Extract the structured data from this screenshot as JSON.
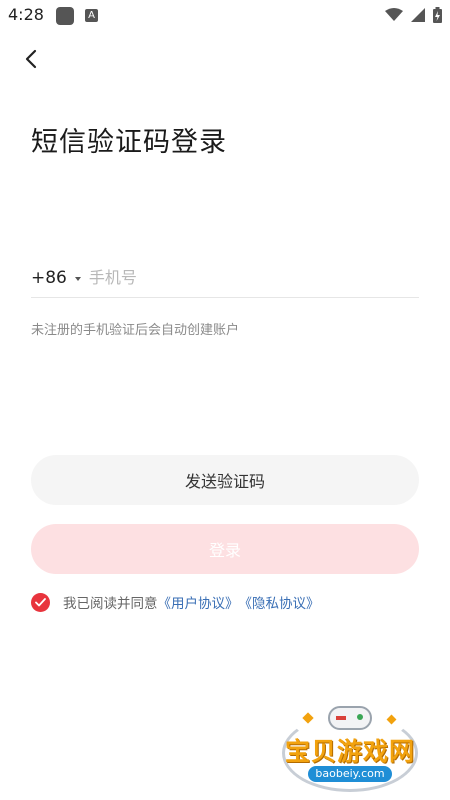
{
  "status_bar": {
    "time": "4:28",
    "app_icon_letter": "A"
  },
  "header": {
    "title": "短信验证码登录"
  },
  "phone": {
    "country_code": "+86",
    "value": "",
    "placeholder": "手机号"
  },
  "hint": "未注册的手机验证后会自动创建账户",
  "buttons": {
    "send_code": "发送验证码",
    "login": "登录"
  },
  "agreement": {
    "checked": true,
    "prefix": "我已阅读并同意",
    "user_agreement": "《用户协议》",
    "privacy_policy": "《隐私协议》"
  },
  "watermark": {
    "name": "宝贝游戏网",
    "url": "baobeiy.com"
  },
  "colors": {
    "accent": "#e8343d",
    "login_disabled": "#fde0e2",
    "link": "#3a6fb5",
    "watermark_text": "#f2a20e"
  }
}
